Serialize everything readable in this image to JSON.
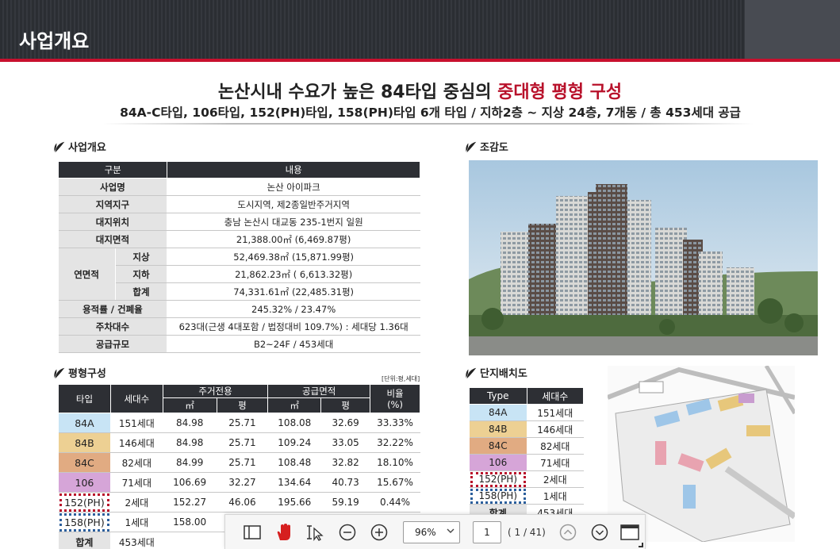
{
  "header": {
    "title": "사업개요"
  },
  "hero": {
    "title_main": "논산시내 수요가 높은 84타입 중심의 ",
    "title_accent": "중대형 평형 구성",
    "subtitle": "84A-C타입, 106타입, 152(PH)타입, 158(PH)타입 6개 타입 / 지하2층 ~ 지상 24층, 7개동 / 총 453세대 공급"
  },
  "overview": {
    "section_title": "사업개요",
    "headers": [
      "구분",
      "내용"
    ],
    "rows": [
      {
        "label": "사업명",
        "value": "논산 아이파크"
      },
      {
        "label": "지역지구",
        "value": "도시지역, 제2종일반주거지역"
      },
      {
        "label": "대지위치",
        "value": "충남 논산시 대교동 235-1번지 일원"
      },
      {
        "label": "대지면적",
        "value": "21,388.00㎡ (6,469.87평)"
      }
    ],
    "floor_area": {
      "label": "연면적",
      "sub": [
        {
          "label": "지상",
          "value": "52,469.38㎡ (15,871.99평)"
        },
        {
          "label": "지하",
          "value": "21,862.23㎡ ( 6,613.32평)"
        },
        {
          "label": "합계",
          "value": "74,331.61㎡ (22,485.31평)"
        }
      ]
    },
    "rows2": [
      {
        "label": "용적률 / 건폐율",
        "value": "245.32% / 23.47%"
      },
      {
        "label": "주차대수",
        "value": "623대(근생 4대포함 / 법정대비 109.7%) : 세대당 1.36대"
      },
      {
        "label": "공급규모",
        "value": "B2~24F / 453세대"
      }
    ]
  },
  "types": {
    "section_title": "평형구성",
    "unit_note": "[단위:평,세대]",
    "headers": {
      "type": "타입",
      "units": "세대수",
      "private": "주거전용",
      "supply": "공급면적",
      "sqm": "㎡",
      "pyeong": "평",
      "ratio": "비율\n(%)"
    },
    "rows": [
      {
        "type": "84A",
        "units": "151세대",
        "p_sqm": "84.98",
        "p_py": "25.71",
        "s_sqm": "108.08",
        "s_py": "32.69",
        "ratio": "33.33%",
        "cls": "c84a"
      },
      {
        "type": "84B",
        "units": "146세대",
        "p_sqm": "84.98",
        "p_py": "25.71",
        "s_sqm": "109.24",
        "s_py": "33.05",
        "ratio": "32.22%",
        "cls": "c84b"
      },
      {
        "type": "84C",
        "units": "82세대",
        "p_sqm": "84.99",
        "p_py": "25.71",
        "s_sqm": "108.48",
        "s_py": "32.82",
        "ratio": "18.10%",
        "cls": "c84c"
      },
      {
        "type": "106",
        "units": "71세대",
        "p_sqm": "106.69",
        "p_py": "32.27",
        "s_sqm": "134.64",
        "s_py": "40.73",
        "ratio": "15.67%",
        "cls": "c106"
      },
      {
        "type": "152(PH)",
        "units": "2세대",
        "p_sqm": "152.27",
        "p_py": "46.06",
        "s_sqm": "195.66",
        "s_py": "59.19",
        "ratio": "0.44%",
        "cls": "dash-red"
      },
      {
        "type": "158(PH)",
        "units": "1세대",
        "p_sqm": "158.00",
        "p_py": "",
        "s_sqm": "",
        "s_py": "",
        "ratio": "",
        "cls": "dash-blue"
      }
    ],
    "total": {
      "label": "합계",
      "units": "453세대"
    }
  },
  "aerial": {
    "section_title": "조감도"
  },
  "layout": {
    "section_title": "단지배치도",
    "headers": [
      "Type",
      "세대수"
    ],
    "rows": [
      {
        "type": "84A",
        "units": "151세대",
        "cls": "c84a"
      },
      {
        "type": "84B",
        "units": "146세대",
        "cls": "c84b"
      },
      {
        "type": "84C",
        "units": "82세대",
        "cls": "c84c"
      },
      {
        "type": "106",
        "units": "71세대",
        "cls": "c106"
      },
      {
        "type": "152(PH)",
        "units": "2세대",
        "cls": "dash-red"
      },
      {
        "type": "158(PH)",
        "units": "1세대",
        "cls": "dash-blue"
      }
    ],
    "total": {
      "label": "합계",
      "units": "453세대"
    }
  },
  "toolbar": {
    "zoom": "96%",
    "page": "1",
    "page_count": "( 1 / 41)",
    "icons": [
      "sidebar-toggle-icon",
      "hand-tool-icon",
      "select-tool-icon",
      "zoom-out-icon",
      "zoom-in-icon",
      "previous-page-icon",
      "next-page-icon",
      "presentation-icon"
    ]
  },
  "colors": {
    "accent_red": "#b8102a",
    "header_dark": "#2b2e33",
    "type_84a": "#c8e4f5",
    "type_84b": "#edd093",
    "type_84c": "#e1ab82",
    "type_106": "#d6a5d8"
  }
}
